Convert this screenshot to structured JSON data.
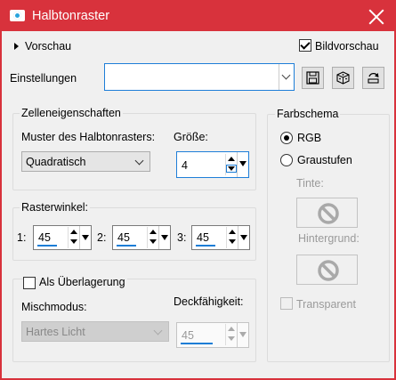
{
  "window": {
    "title": "Halbtonraster"
  },
  "preview": {
    "toggle_label": "Vorschau",
    "checkbox_label": "Bildvorschau",
    "checked": true
  },
  "settings": {
    "label": "Einstellungen",
    "value": ""
  },
  "cell_properties": {
    "group_label": "Zelleneigenschaften",
    "pattern_label": "Muster des Halbtonrasters:",
    "pattern_value": "Quadratisch",
    "size_label": "Größe:",
    "size_value": "4"
  },
  "screen_angles": {
    "group_label": "Rasterwinkel:",
    "items": [
      {
        "label": "1:",
        "value": "45"
      },
      {
        "label": "2:",
        "value": "45"
      },
      {
        "label": "3:",
        "value": "45"
      }
    ]
  },
  "overlay": {
    "checkbox_label": "Als Überlagerung",
    "checked": false,
    "blend_label": "Mischmodus:",
    "blend_value": "Hartes Licht",
    "opacity_label": "Deckfähigkeit:",
    "opacity_value": "45"
  },
  "color_scheme": {
    "group_label": "Farbschema",
    "rgb_label": "RGB",
    "grayscale_label": "Graustufen",
    "selected": "RGB",
    "ink_label": "Tinte:",
    "background_label": "Hintergrund:",
    "transparent_label": "Transparent"
  },
  "colors": {
    "title_bar": "#d8323c",
    "accent": "#1c7dd6"
  }
}
